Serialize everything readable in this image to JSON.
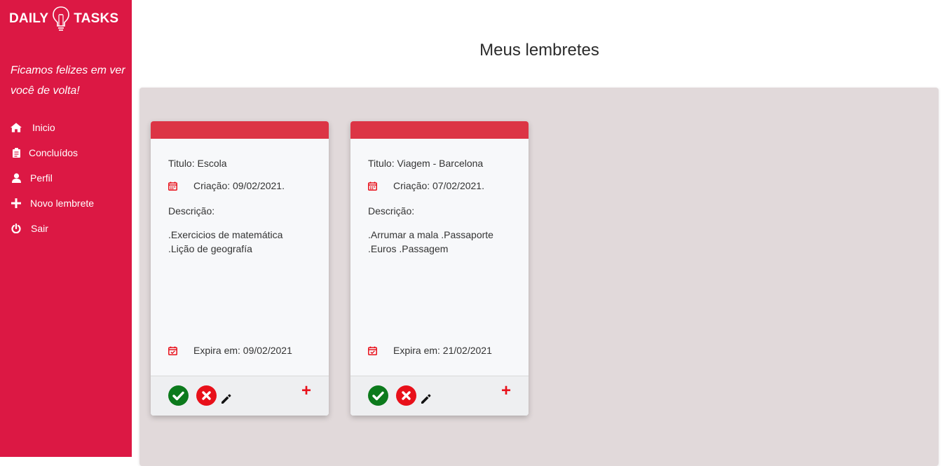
{
  "brand": {
    "word1": "DAILY",
    "word2": "TASKS"
  },
  "sidebar": {
    "welcome": "Ficamos felizes em ver você de volta!",
    "items": [
      {
        "label": "Inicio",
        "icon": "home-icon"
      },
      {
        "label": "Concluídos",
        "icon": "clipboard-icon"
      },
      {
        "label": "Perfil",
        "icon": "user-icon"
      },
      {
        "label": "Novo lembrete",
        "icon": "plus-icon"
      },
      {
        "label": "Sair",
        "icon": "power-icon"
      }
    ]
  },
  "main": {
    "title": "Meus lembretes",
    "cards": [
      {
        "title": "Titulo: Escola",
        "created": "Criação: 09/02/2021.",
        "desc_label": "Descrição:",
        "desc": ".Exercicios de matemática .Lição de geografía",
        "expires": "Expira em: 09/02/2021",
        "add_label": "+"
      },
      {
        "title": "Titulo: Viagem - Barcelona",
        "created": "Criação: 07/02/2021.",
        "desc_label": "Descrição:",
        "desc": ".Arrumar a mala .Passaporte .Euros .Passagem",
        "expires": "Expira em: 21/02/2021",
        "add_label": "+"
      }
    ]
  },
  "colors": {
    "sidebar": "#dc1844",
    "card_header": "#dc3545",
    "panel": "#e1d9da",
    "confirm": "#0c7a1c",
    "cancel": "#e8101a"
  }
}
